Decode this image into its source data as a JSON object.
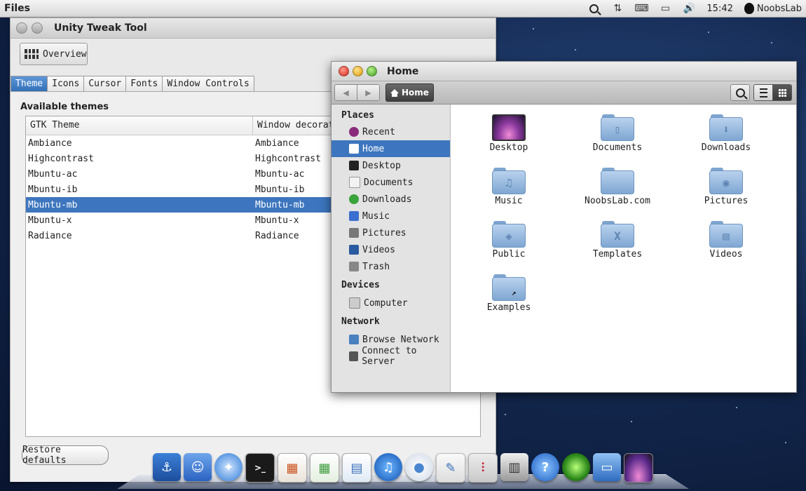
{
  "top_panel": {
    "app_name": "Files",
    "clock": "15:42",
    "user": "NoobsLab"
  },
  "tweak_tool": {
    "title": "Unity Tweak Tool",
    "overview_label": "Overview",
    "tabs": [
      "Theme",
      "Icons",
      "Cursor",
      "Fonts",
      "Window Controls"
    ],
    "active_tab": "Theme",
    "section_label": "Available themes",
    "columns": [
      "GTK Theme",
      "Window decoratio"
    ],
    "themes": [
      {
        "gtk": "Ambiance",
        "window": "Ambiance"
      },
      {
        "gtk": "Highcontrast",
        "window": "Highcontrast"
      },
      {
        "gtk": "Mbuntu-ac",
        "window": "Mbuntu-ac"
      },
      {
        "gtk": "Mbuntu-ib",
        "window": "Mbuntu-ib"
      },
      {
        "gtk": "Mbuntu-mb",
        "window": "Mbuntu-mb"
      },
      {
        "gtk": "Mbuntu-x",
        "window": "Mbuntu-x"
      },
      {
        "gtk": "Radiance",
        "window": "Radiance"
      }
    ],
    "selected_theme": "Mbuntu-mb",
    "restore_label": "Restore defaults"
  },
  "file_manager": {
    "title": "Home",
    "breadcrumb": "Home",
    "sidebar": {
      "places_label": "Places",
      "places": [
        "Recent",
        "Home",
        "Desktop",
        "Documents",
        "Downloads",
        "Music",
        "Pictures",
        "Videos",
        "Trash"
      ],
      "selected": "Home",
      "devices_label": "Devices",
      "devices": [
        "Computer"
      ],
      "network_label": "Network",
      "network": [
        "Browse Network",
        "Connect to Server"
      ]
    },
    "files": [
      "Desktop",
      "Documents",
      "Downloads",
      "Music",
      "NoobsLab.com",
      "Pictures",
      "Public",
      "Templates",
      "Videos",
      "Examples"
    ]
  },
  "dock": {
    "items": [
      "anchor-icon",
      "finder-icon",
      "safari-icon",
      "terminal-icon",
      "impress-icon",
      "calc-icon",
      "writer-icon",
      "itunes-icon",
      "chat-icon",
      "texteditor-icon",
      "mixer-icon",
      "trash-icon",
      "help-icon",
      "green-orb-icon",
      "finder-window-icon",
      "photos-icon"
    ]
  },
  "colors": {
    "selection": "#3d76be",
    "folder": "#8fb3db",
    "active_tab": "#3f7cc4"
  }
}
